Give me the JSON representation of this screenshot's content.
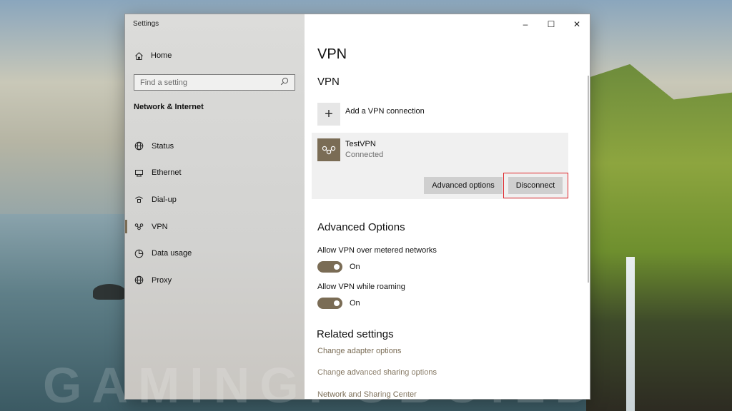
{
  "window": {
    "title": "Settings",
    "caption": {
      "minimize": "–",
      "maximize": "☐",
      "close": "✕"
    }
  },
  "sidebar": {
    "home_label": "Home",
    "search_placeholder": "Find a setting",
    "section_label": "Network & Internet",
    "items": [
      {
        "label": "Status",
        "icon": "globe-icon",
        "active": false
      },
      {
        "label": "Ethernet",
        "icon": "ethernet-icon",
        "active": false
      },
      {
        "label": "Dial-up",
        "icon": "dialup-icon",
        "active": false
      },
      {
        "label": "VPN",
        "icon": "vpn-icon",
        "active": true
      },
      {
        "label": "Data usage",
        "icon": "data-usage-icon",
        "active": false
      },
      {
        "label": "Proxy",
        "icon": "globe-icon",
        "active": false
      }
    ]
  },
  "main": {
    "page_title": "VPN",
    "vpn_heading": "VPN",
    "add_vpn_label": "Add a VPN connection",
    "connection": {
      "name": "TestVPN",
      "status": "Connected",
      "advanced_button": "Advanced options",
      "disconnect_button": "Disconnect"
    },
    "advanced_heading": "Advanced Options",
    "options": [
      {
        "label": "Allow VPN over metered networks",
        "state": "On"
      },
      {
        "label": "Allow VPN while roaming",
        "state": "On"
      }
    ],
    "related_heading": "Related settings",
    "links": [
      "Change adapter options",
      "Change advanced sharing options",
      "Network and Sharing Center"
    ]
  },
  "watermark": "GAMINGPCBUILD",
  "colors": {
    "accent": "#7a6c55",
    "highlight": "#e0262a",
    "sidebar_bg": "#d6d6d4"
  }
}
